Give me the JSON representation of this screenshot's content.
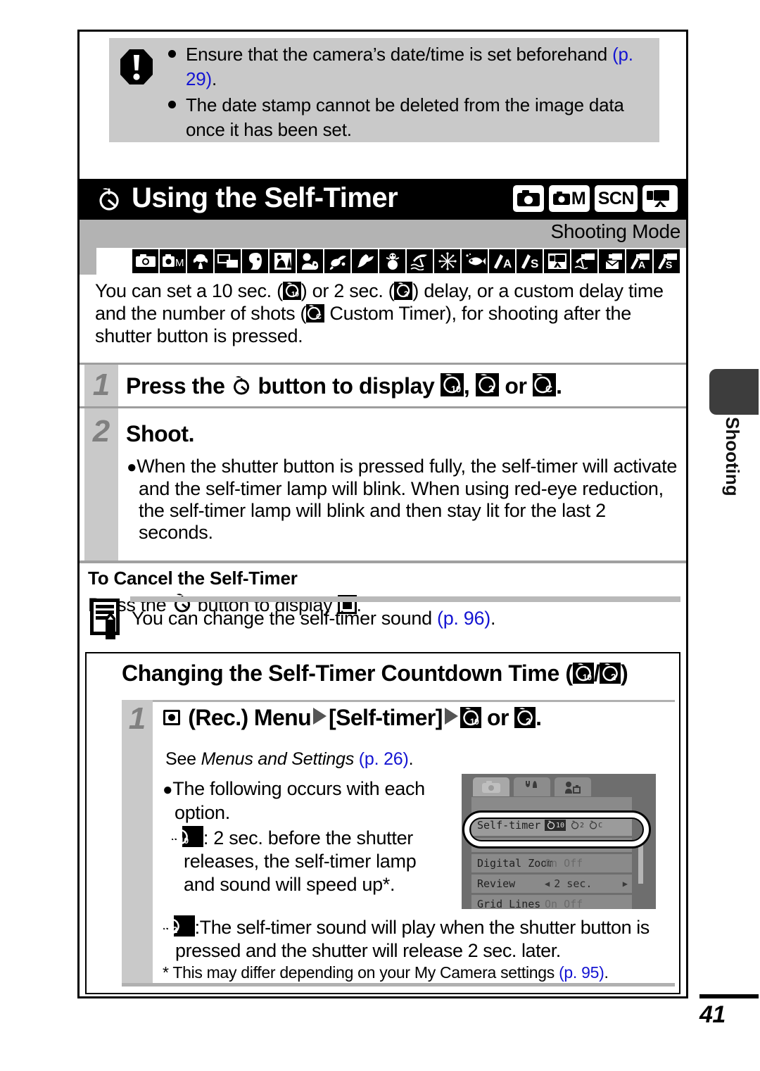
{
  "page": {
    "number": "41",
    "side_tab_label": "Shooting"
  },
  "warning": {
    "icon": "exclamation-octagon-icon",
    "items": [
      {
        "text_before": "Ensure that the camera’s date/time is set beforehand ",
        "page_ref": "(p. 29)",
        "text_after": "."
      },
      {
        "text_before": "The date stamp cannot be deleted from the image data once it has been set.",
        "page_ref": "",
        "text_after": ""
      }
    ]
  },
  "title_bar": {
    "icon": "self-timer-icon",
    "title": "Using the Self-Timer",
    "mode_chips": [
      {
        "name": "auto-mode-chip",
        "label": ""
      },
      {
        "name": "manual-mode-chip",
        "label": "M"
      },
      {
        "name": "scene-mode-chip",
        "label": "SCN"
      },
      {
        "name": "movie-mode-chip",
        "label": ""
      }
    ]
  },
  "mode_strip": {
    "label": "Shooting Mode",
    "icons": [
      "auto-icon",
      "manual-icon",
      "macro-icon",
      "digital-macro-icon",
      "portrait-icon",
      "night-snapshot-icon",
      "kids-and-pets-icon",
      "indoor-icon",
      "foliage-icon",
      "snow-icon",
      "beach-icon",
      "fireworks-icon",
      "underwater-icon",
      "aquarium-icon",
      "iso-auto-icon",
      "movie-standard-icon",
      "movie-beach-icon",
      "movie-compact-icon",
      "movie-color-accent-icon",
      "movie-color-swap-icon"
    ]
  },
  "intro": {
    "part1": "You can set a 10 sec. (",
    "part2": ") or 2 sec. (",
    "part3": ") delay, or a custom delay time and the number of shots (",
    "part4": " Custom Timer), for shooting after the shutter button is pressed."
  },
  "steps": [
    {
      "number": "1",
      "text_a": "Press the ",
      "text_b": " button to display ",
      "text_c": ", ",
      "text_d": " or ",
      "text_e": "."
    },
    {
      "number": "2",
      "text_a": "Shoot.",
      "text_b": "",
      "text_c": "",
      "text_d": "",
      "text_e": ""
    }
  ],
  "step2_bullet": "When the shutter button is pressed fully, the self-timer will activate and the self-timer lamp will blink. When using red-eye reduction, the self-timer lamp will blink and then stay lit for the last 2 seconds.",
  "cancel": {
    "heading": "To Cancel the Self-Timer",
    "body_before": "Press the ",
    "body_mid": " button to display ",
    "body_after": "."
  },
  "note": {
    "icon": "note-pencil-icon",
    "text_before": "You can change the self-timer sound ",
    "page_ref": "(p. 96)",
    "text_after": "."
  },
  "countdown": {
    "title_text": "Changing the Self-Timer Countdown Time (",
    "title_sep": "/",
    "title_close": ")",
    "step_number": "1",
    "step_text_a": " (Rec.) Menu",
    "step_text_b": "[Self-timer]",
    "step_text_c": " or ",
    "step_text_d": ".",
    "see_prefix": "See ",
    "see_italic": "Menus and Settings ",
    "see_page_ref": "(p. 26)",
    "see_after": ".",
    "bullet_main": "The following occurs with each option.",
    "dash1_text": ": 2 sec. before the shutter releases, the self-timer lamp and sound will speed up*.",
    "dash2_text": ":The self-timer sound will play when the shutter button is pressed and the shutter will release 2 sec. later.",
    "footnote_before": "* This may differ depending on your My Camera settings ",
    "footnote_page_ref": "(p. 95)",
    "footnote_after": "."
  },
  "lcd": {
    "tabs": [
      {
        "name": "lcd-tab-rec",
        "icon": "camera-icon",
        "active": true
      },
      {
        "name": "lcd-tab-setup",
        "icon": "tools-icon",
        "active": false
      },
      {
        "name": "lcd-tab-mycamera",
        "icon": "my-camera-icon",
        "active": false
      }
    ],
    "rows": [
      {
        "label": "Self-timer",
        "value": "",
        "selected": true,
        "options": [
          "10",
          "2",
          "C"
        ]
      },
      {
        "label": "Digital Zoom",
        "value": "On  Off",
        "selected": false,
        "options": []
      },
      {
        "label": "Review",
        "value": "2 sec.",
        "selected": false,
        "options": []
      },
      {
        "label": "Grid Lines",
        "value": "On  Off",
        "selected": false,
        "options": []
      }
    ]
  },
  "colors": {
    "page_ref_blue": "#1414d2",
    "band_gray": "#c9c9c9",
    "strip_gray": "#b3b3b3",
    "title_black": "#000000"
  }
}
